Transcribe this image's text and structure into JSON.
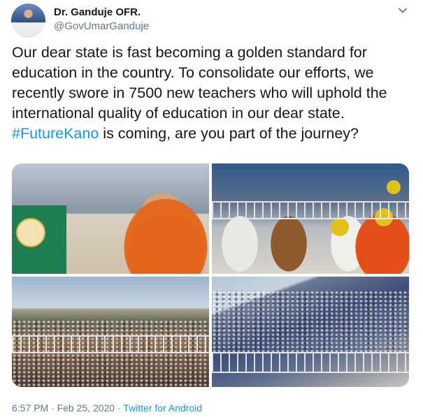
{
  "author": {
    "name": "Dr. Ganduje OFR.",
    "handle": "@GovUmarGanduje"
  },
  "tweet": {
    "text_before": "Our dear state is fast becoming a golden standard for education in the country. To consolidate our efforts, we recently swore in 7500 new teachers who will uphold the international quality of education in our dear state. ",
    "hashtag": "#FutureKano",
    "text_after": " is coming, are you part of the journey?"
  },
  "media": {
    "photos": [
      {
        "id": "photo-1"
      },
      {
        "id": "photo-2"
      },
      {
        "id": "photo-3"
      },
      {
        "id": "photo-4"
      }
    ]
  },
  "footer": {
    "timestamp": "6:57 PM · Feb 25, 2020",
    "separator": " · ",
    "source": "Twitter for Android"
  },
  "icons": {
    "caret": "chevron-down-icon"
  },
  "colors": {
    "link": "#1b95e0",
    "secondary_text": "#657786",
    "primary_text": "#14171a"
  }
}
